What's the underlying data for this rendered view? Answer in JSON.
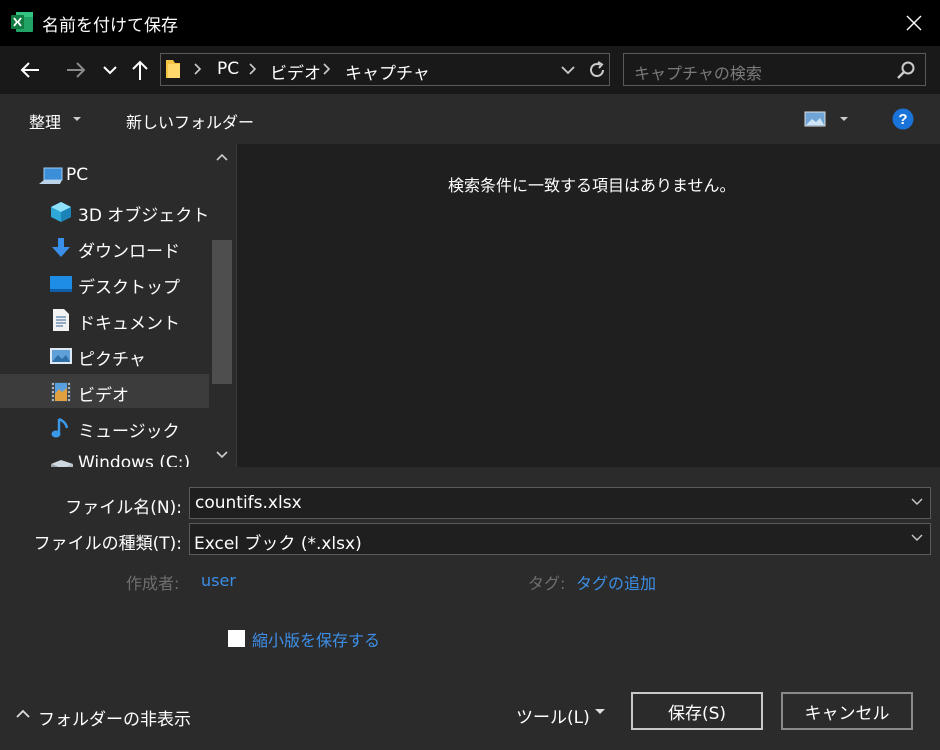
{
  "window": {
    "title": "名前を付けて保存"
  },
  "nav": {
    "breadcrumbs": [
      "PC",
      "ビデオ",
      "キャプチャ"
    ],
    "search_placeholder": "キャプチャの検索"
  },
  "toolbar": {
    "organize_label": "整理",
    "new_folder_label": "新しいフォルダー"
  },
  "sidebar": {
    "items": [
      {
        "label": "PC",
        "icon": "pc-icon"
      },
      {
        "label": "3D オブジェクト",
        "icon": "3d-objects-icon"
      },
      {
        "label": "ダウンロード",
        "icon": "download-icon"
      },
      {
        "label": "デスクトップ",
        "icon": "desktop-icon"
      },
      {
        "label": "ドキュメント",
        "icon": "documents-icon"
      },
      {
        "label": "ピクチャ",
        "icon": "pictures-icon"
      },
      {
        "label": "ビデオ",
        "icon": "videos-icon",
        "selected": true
      },
      {
        "label": "ミュージック",
        "icon": "music-icon"
      },
      {
        "label": "Windows (C:)",
        "icon": "drive-icon"
      }
    ]
  },
  "content": {
    "empty_message": "検索条件に一致する項目はありません。"
  },
  "form": {
    "filename_label": "ファイル名(N):",
    "filename_value": "countifs.xlsx",
    "filetype_label": "ファイルの種類(T):",
    "filetype_value": "Excel ブック (*.xlsx)",
    "author_label": "作成者:",
    "author_value": "user",
    "tags_label": "タグ:",
    "tags_value": "タグの追加",
    "thumbnail_label": "縮小版を保存する"
  },
  "footer": {
    "hide_folders_label": "フォルダーの非表示",
    "tools_label": "ツール(L)",
    "save_label": "保存(S)",
    "cancel_label": "キャンセル"
  },
  "colors": {
    "accent": "#3d8ee6",
    "excel_green": "#1e7145",
    "background": "#1f1f1f"
  }
}
